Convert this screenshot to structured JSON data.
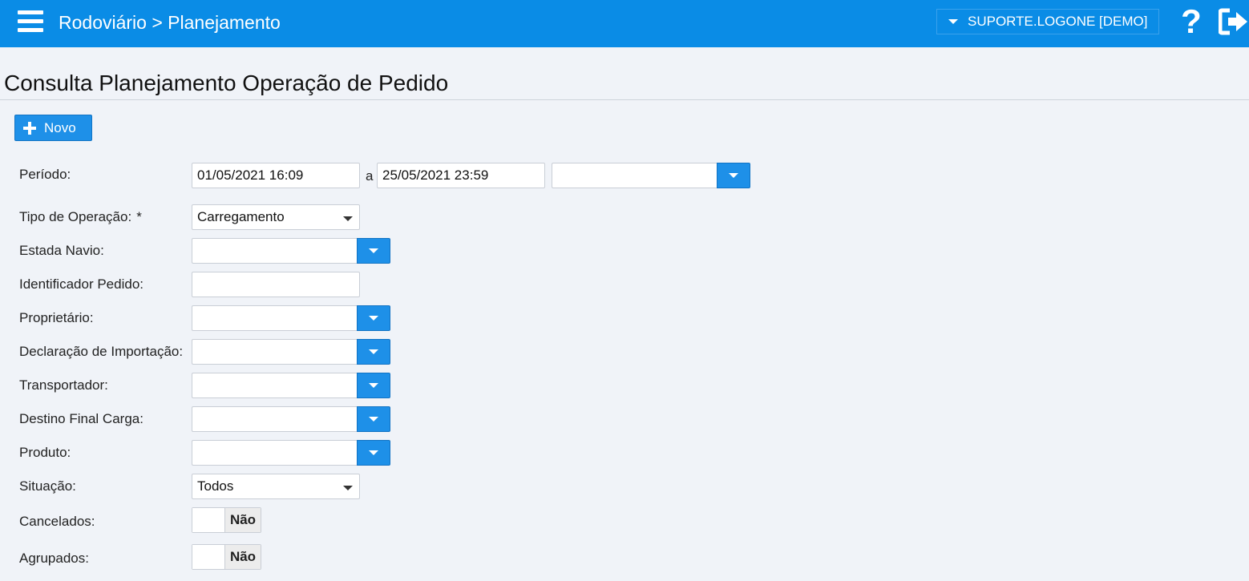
{
  "header": {
    "breadcrumb": "Rodoviário > Planejamento",
    "user": "SUPORTE.LOGONE [DEMO]",
    "help_glyph": "?"
  },
  "page": {
    "title": "Consulta Planejamento Operação de Pedido"
  },
  "toolbar": {
    "new_label": "Novo"
  },
  "form": {
    "periodo": {
      "label": "Período:",
      "start": "01/05/2021 16:09",
      "separator": "a",
      "end": "25/05/2021 23:59",
      "preset": ""
    },
    "tipo_operacao": {
      "label": "Tipo de Operação:",
      "required_mark": "*",
      "value": "Carregamento"
    },
    "estada_navio": {
      "label": "Estada Navio:",
      "value": ""
    },
    "identificador_pedido": {
      "label": "Identificador Pedido:",
      "value": ""
    },
    "proprietario": {
      "label": "Proprietário:",
      "value": ""
    },
    "declaracao_importacao": {
      "label": "Declaração de Importação:",
      "value": ""
    },
    "transportador": {
      "label": "Transportador:",
      "value": ""
    },
    "destino_final_carga": {
      "label": "Destino Final Carga:",
      "value": ""
    },
    "produto": {
      "label": "Produto:",
      "value": ""
    },
    "situacao": {
      "label": "Situação:",
      "value": "Todos"
    },
    "cancelados": {
      "label": "Cancelados:",
      "value": "Não"
    },
    "agrupados": {
      "label": "Agrupados:",
      "value": "Não"
    }
  },
  "colors": {
    "accent": "#0a8ce6",
    "button": "#1e90e8",
    "background": "#f0f3f8"
  },
  "icons": [
    "menu-icon",
    "caret-down-icon",
    "help-icon",
    "logout-icon",
    "plus-icon"
  ]
}
